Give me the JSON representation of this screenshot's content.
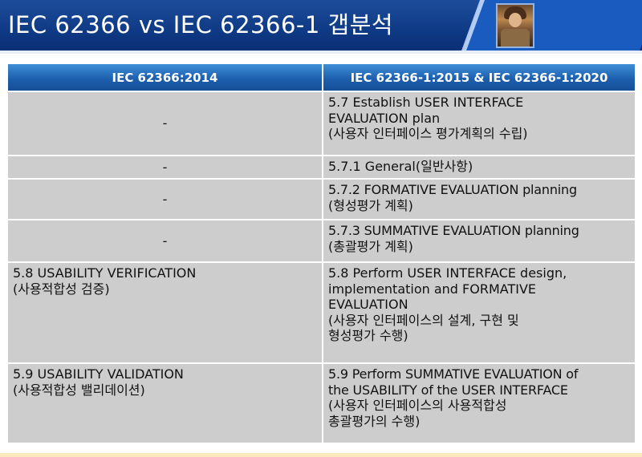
{
  "header": {
    "title": "IEC 62366 vs IEC 62366-1 갭분석"
  },
  "table": {
    "columns": [
      "IEC 62366:2014",
      "IEC 62366-1:2015 & IEC 62366-1:2020"
    ],
    "rows": [
      {
        "left": [
          "-"
        ],
        "right": [
          "5.7 Establish USER INTERFACE",
          "EVALUATION plan",
          "(사용자 인터페이스 평가계획의 수립)"
        ]
      },
      {
        "left": [
          "-"
        ],
        "right": [
          "5.7.1 General(일반사항)"
        ]
      },
      {
        "left": [
          "-"
        ],
        "right": [
          "5.7.2 FORMATIVE EVALUATION planning",
          "(형성평가 계획)"
        ]
      },
      {
        "left": [
          "-"
        ],
        "right": [
          "5.7.3 SUMMATIVE EVALUATION planning",
          "(총괄평가 계획)"
        ]
      },
      {
        "left": [
          "5.8 USABILITY VERIFICATION",
          "(사용적합성 검증)"
        ],
        "right": [
          "5.8 Perform USER INTERFACE design,",
          "implementation and FORMATIVE",
          "EVALUATION",
          "(사용자 인터페이스의 설계, 구현 및",
          "형성평가 수행)"
        ]
      },
      {
        "left": [
          "5.9 USABILITY VALIDATION",
          "(사용적합성 밸리데이션)"
        ],
        "right": [
          "5.9 Perform SUMMATIVE EVALUATION of",
          "the USABILITY of the USER INTERFACE",
          "(사용자 인터페이스의 사용적합성",
          "총괄평가의 수행)"
        ]
      }
    ]
  },
  "colors": {
    "banner": "#0f3a86",
    "header_cell": "#1d5fae",
    "body_cell": "#cdcdcd"
  }
}
